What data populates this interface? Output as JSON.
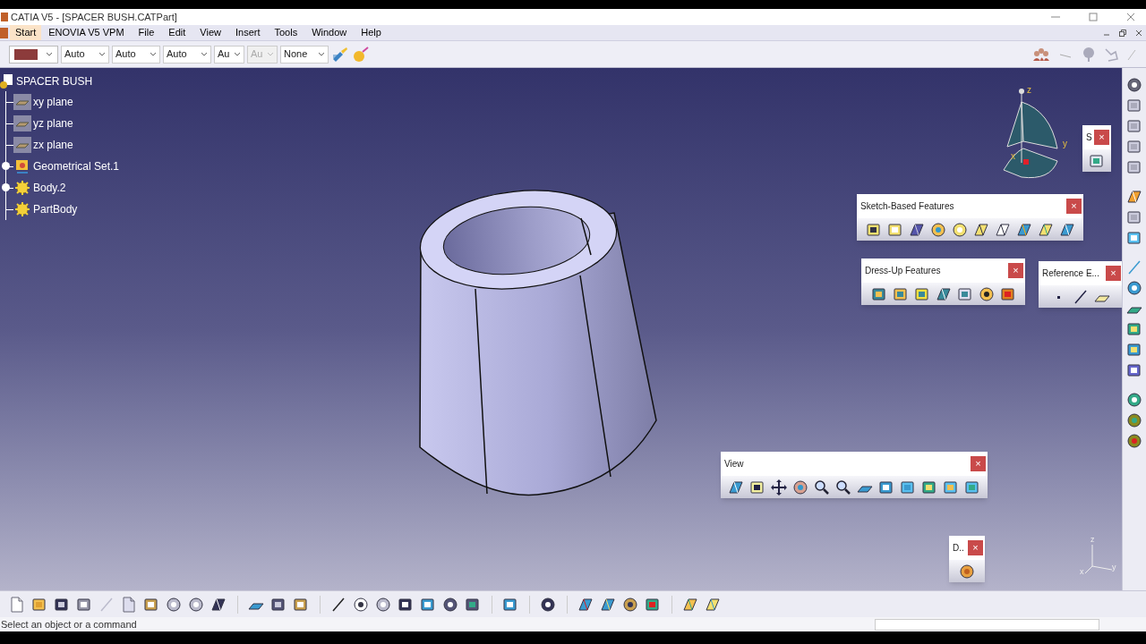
{
  "window": {
    "title": "CATIA V5 - [SPACER BUSH.CATPart]"
  },
  "menu": [
    {
      "label": "Start",
      "selected": true
    },
    {
      "label": "ENOVIA V5 VPM",
      "selected": false
    },
    {
      "label": "File",
      "selected": false
    },
    {
      "label": "Edit",
      "selected": false
    },
    {
      "label": "View",
      "selected": false
    },
    {
      "label": "Insert",
      "selected": false
    },
    {
      "label": "Tools",
      "selected": false
    },
    {
      "label": "Window",
      "selected": false
    },
    {
      "label": "Help",
      "selected": false
    }
  ],
  "properties_toolbar": {
    "combos": [
      {
        "value": "Auto",
        "disabled": false
      },
      {
        "value": "Auto",
        "disabled": false
      },
      {
        "value": "Auto",
        "disabled": false
      },
      {
        "value": "Au",
        "disabled": false
      },
      {
        "value": "Au",
        "disabled": true
      },
      {
        "value": "None",
        "disabled": false
      }
    ]
  },
  "tree": {
    "label": "SPACER BUSH",
    "children": [
      {
        "label": "xy plane",
        "kind": "plane",
        "expandable": false
      },
      {
        "label": "yz plane",
        "kind": "plane",
        "expandable": false
      },
      {
        "label": "zx plane",
        "kind": "plane",
        "expandable": false
      },
      {
        "label": "Geometrical Set.1",
        "kind": "geoset",
        "expandable": true
      },
      {
        "label": "Body.2",
        "kind": "body",
        "expandable": true
      },
      {
        "label": "PartBody",
        "kind": "body",
        "expandable": false
      }
    ]
  },
  "compass": {
    "axes": [
      "z",
      "y",
      "x"
    ]
  },
  "floating_toolbars": [
    {
      "title": "S",
      "close": "×"
    },
    {
      "title": "Sketch-Based Features",
      "close": "×"
    },
    {
      "title": "Dress-Up Features",
      "close": "×"
    },
    {
      "title": "Reference E...",
      "close": "×"
    },
    {
      "title": "View",
      "close": "×"
    },
    {
      "title": "D..",
      "close": "×"
    }
  ],
  "axis_triad": {
    "axes": [
      "z",
      "y",
      "x"
    ]
  },
  "status_bar": {
    "message": "Select an object or a command"
  }
}
